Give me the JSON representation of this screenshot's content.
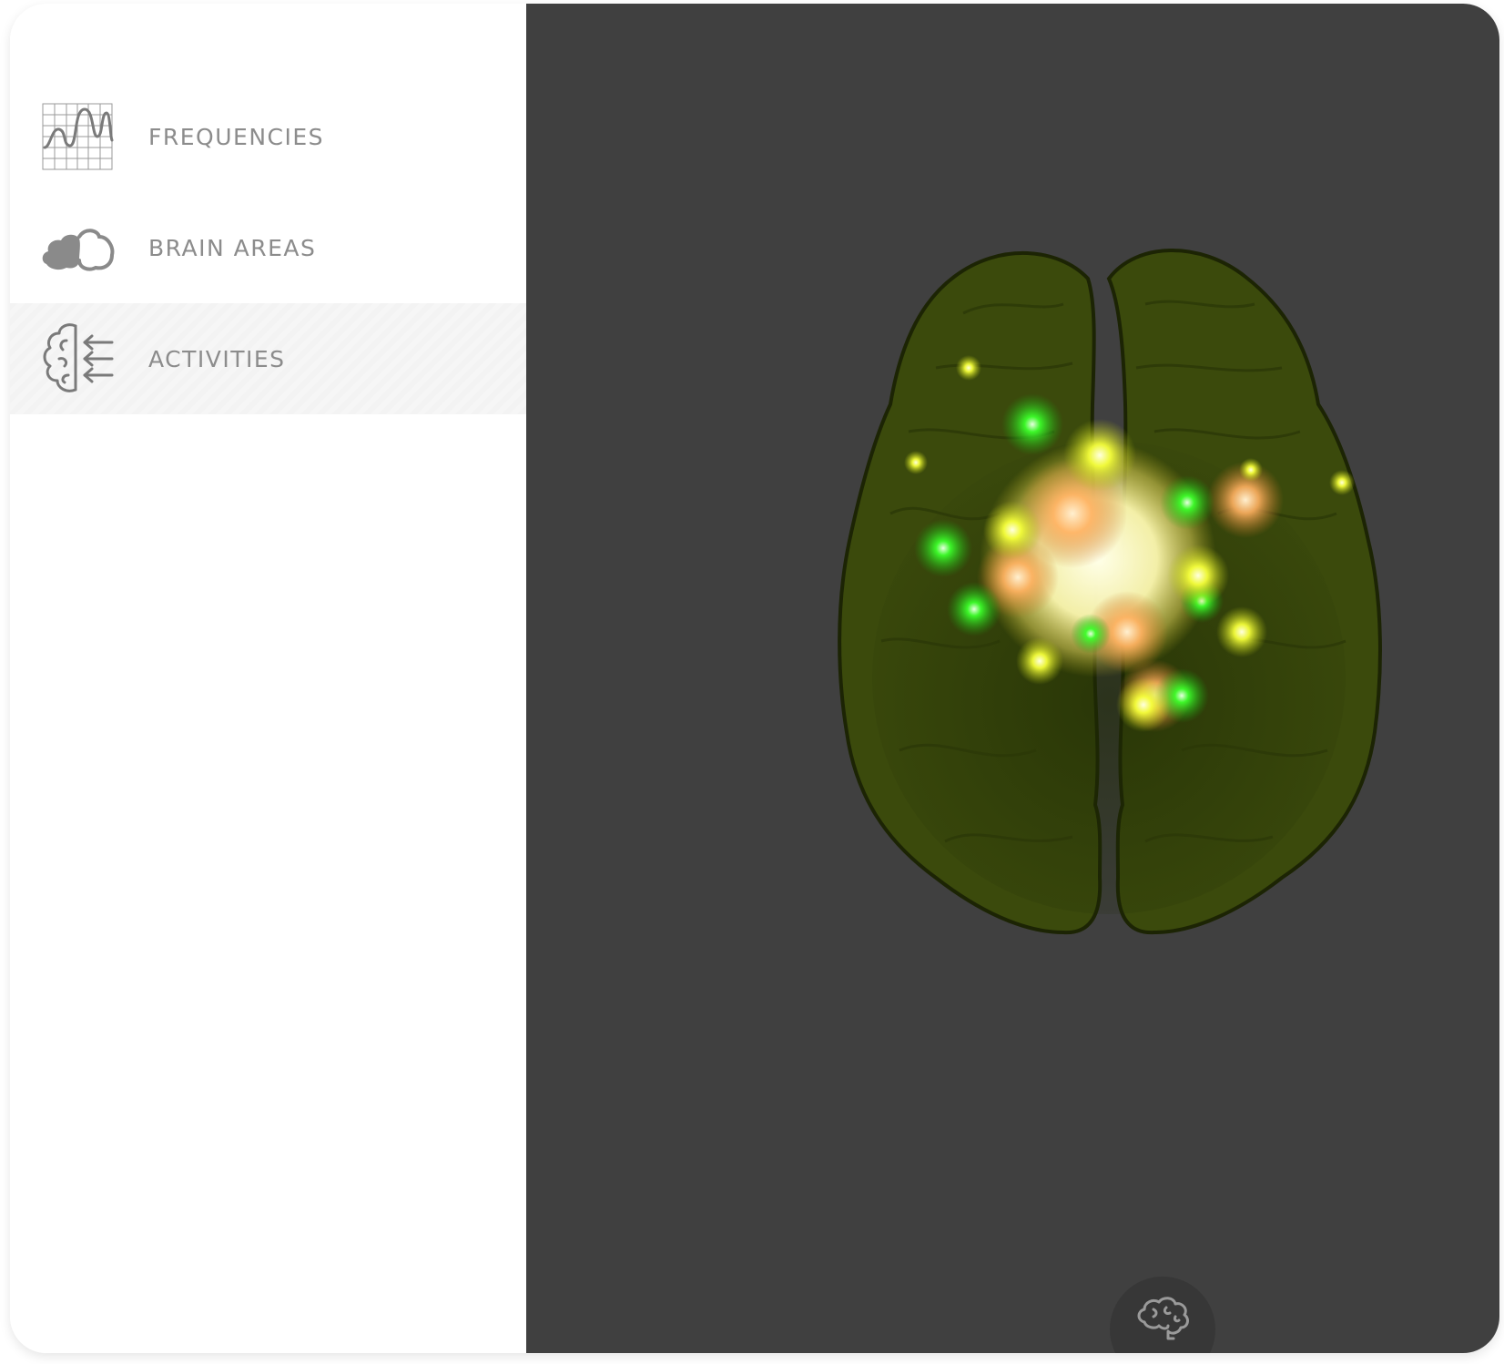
{
  "sidebar": {
    "items": [
      {
        "label": "FREQUENCIES",
        "icon": "frequency-wave-icon",
        "active": false
      },
      {
        "label": "BRAIN AREAS",
        "icon": "brain-areas-icon",
        "active": false
      },
      {
        "label": "ACTIVITIES",
        "icon": "brain-activity-icon",
        "active": true
      }
    ]
  },
  "viewer": {
    "background": "#404040",
    "model": "brain-3d-top-view",
    "toggle_button_icon": "brain-icon"
  },
  "colors": {
    "label": "#8c8c8c",
    "brain": "#3b4a0c",
    "glow_green": "#3cff2a",
    "glow_yellow": "#f5ff3a",
    "glow_orange": "#ffb060",
    "glow_core": "#ffffd0"
  }
}
